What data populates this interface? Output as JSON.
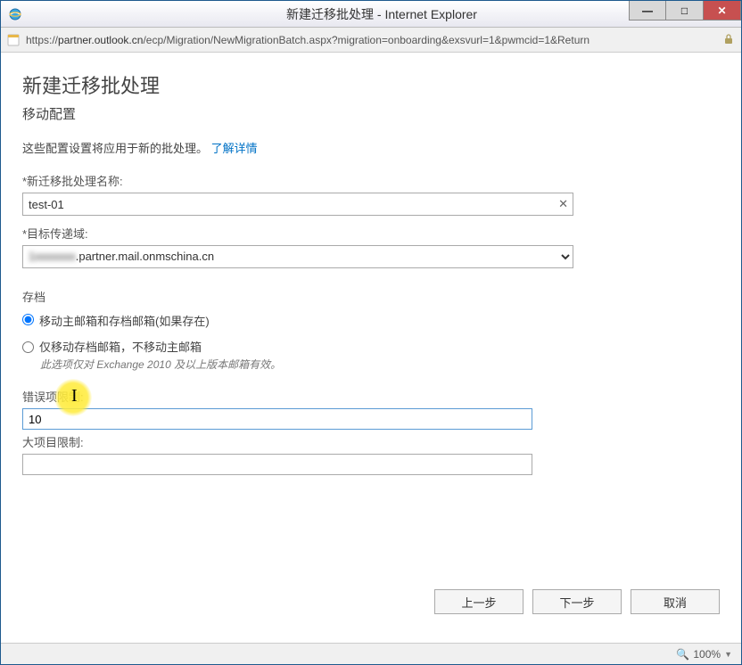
{
  "window": {
    "title": "新建迁移批处理 - Internet Explorer",
    "url_prefix": "https://",
    "url_host": "partner.outlook.cn",
    "url_path": "/ecp/Migration/NewMigrationBatch.aspx?migration=onboarding&exsvurl=1&pwmcid=1&Return"
  },
  "page": {
    "title": "新建迁移批处理",
    "subtitle": "移动配置",
    "description": "这些配置设置将应用于新的批处理。",
    "learn_more": "了解详情"
  },
  "fields": {
    "batch_name_label": "*新迁移批处理名称:",
    "batch_name_value": "test-01",
    "target_domain_label": "*目标传递域:",
    "target_domain_value_prefix": "1xxxxxxx",
    "target_domain_value_suffix": ".partner.mail.onmschina.cn",
    "archive_header": "存档",
    "radio1_label": "移动主邮箱和存档邮箱(如果存在)",
    "radio2_label": "仅移动存档邮箱，不移动主邮箱",
    "radio2_sub": "此选项仅对 Exchange 2010 及以上版本邮箱有效。",
    "bad_item_label": "错误项限制:",
    "bad_item_value": "10",
    "large_item_label": "大项目限制:",
    "large_item_value": ""
  },
  "buttons": {
    "prev": "上一步",
    "next": "下一步",
    "cancel": "取消"
  },
  "status": {
    "zoom": "100%"
  }
}
